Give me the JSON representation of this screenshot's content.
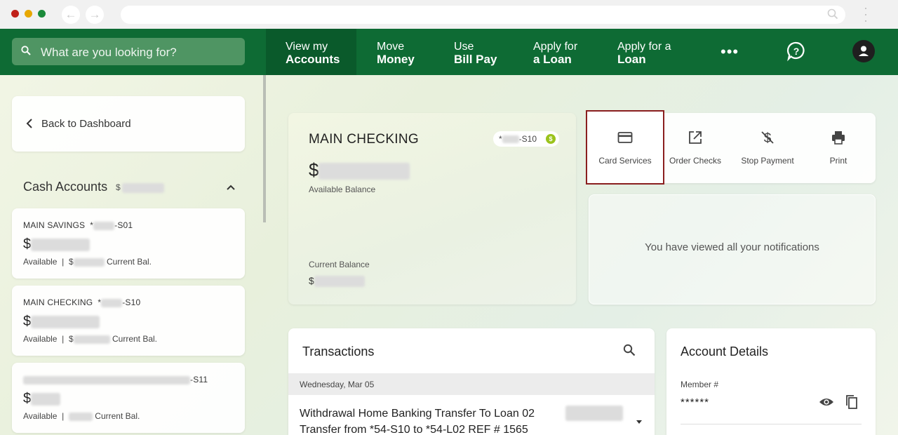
{
  "browser": {
    "back_glyph": "←",
    "forward_glyph": "→",
    "url": ""
  },
  "topnav": {
    "search_placeholder": "What are you looking for?",
    "items": [
      {
        "line1": "View my",
        "line2": "Accounts"
      },
      {
        "line1": "Move",
        "line2": "Money"
      },
      {
        "line1": "Use",
        "line2": "Bill Pay"
      },
      {
        "line1": "Apply for",
        "line2": "a Loan"
      },
      {
        "line1": "Apply for a",
        "line2": "Loan"
      }
    ],
    "more": "•••"
  },
  "sidebar": {
    "back_label": "Back to Dashboard",
    "section_title": "Cash Accounts",
    "section_amount_prefix": "$",
    "accounts": [
      {
        "name": "MAIN SAVINGS",
        "mask_prefix": "*",
        "suffix": "-S01",
        "currency": "$",
        "available": "Available",
        "sep": "|",
        "current_prefix": "$",
        "current_label": "Current Bal."
      },
      {
        "name": "MAIN CHECKING",
        "mask_prefix": "*",
        "suffix": "-S10",
        "currency": "$",
        "available": "Available",
        "sep": "|",
        "current_prefix": "$",
        "current_label": "Current Bal."
      },
      {
        "name": "",
        "mask_prefix": "",
        "suffix": "-S11",
        "currency": "$",
        "available": "Available",
        "sep": "|",
        "current_prefix": "",
        "current_label": "Current Bal."
      }
    ]
  },
  "main_account": {
    "title": "MAIN CHECKING",
    "mask_prefix": "*",
    "suffix": "-S10",
    "coin": "$",
    "currency": "$",
    "available_label": "Available Balance",
    "current_label": "Current Balance",
    "current_currency": "$"
  },
  "actions": [
    {
      "label": "Card Services",
      "icon": "credit-card-icon",
      "highlighted": true
    },
    {
      "label": "Order Checks",
      "icon": "external-link-icon",
      "highlighted": false
    },
    {
      "label": "Stop Payment",
      "icon": "money-off-icon",
      "highlighted": false
    },
    {
      "label": "Print",
      "icon": "printer-icon",
      "highlighted": false
    }
  ],
  "notifications": {
    "message": "You have viewed all your notifications"
  },
  "transactions": {
    "title": "Transactions",
    "date": "Wednesday, Mar 05",
    "item_line1": "Withdrawal Home Banking Transfer To Loan 02",
    "item_line2": "Transfer from *54-S10 to *54-L02 REF # 1565"
  },
  "account_details": {
    "title": "Account Details",
    "member_label": "Member #",
    "member_value": "******"
  },
  "colors": {
    "nav_green": "#0e6b34",
    "nav_active": "#0a5a2b",
    "highlight_border": "#8a1f1f",
    "coin_green": "#9bc31c"
  }
}
